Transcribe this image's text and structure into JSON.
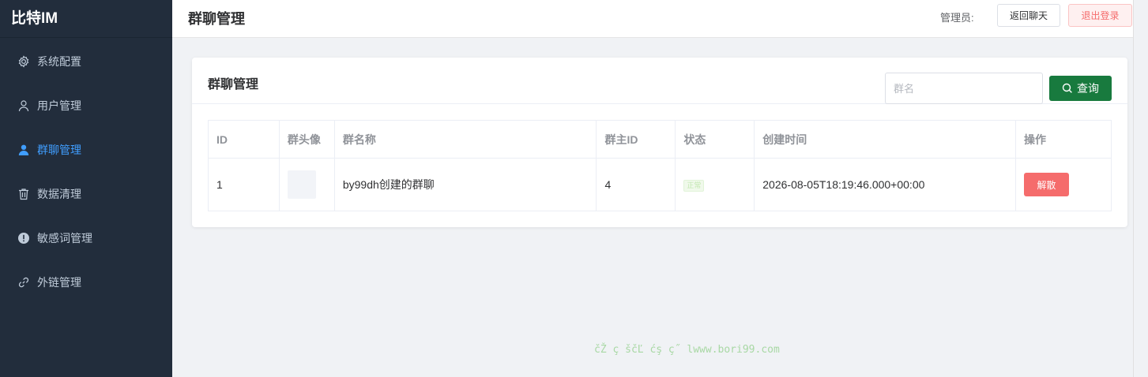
{
  "sidebar": {
    "brand": "比特IM",
    "items": [
      {
        "label": "系统配置",
        "icon": "gear-icon"
      },
      {
        "label": "用户管理",
        "icon": "user-outline-icon"
      },
      {
        "label": "群聊管理",
        "icon": "user-filled-icon",
        "active": true
      },
      {
        "label": "数据清理",
        "icon": "trash-icon"
      },
      {
        "label": "敏感词管理",
        "icon": "warning-icon"
      },
      {
        "label": "外链管理",
        "icon": "link-icon"
      }
    ]
  },
  "header": {
    "title": "群聊管理",
    "admin_label": "管理员:",
    "back_button": "返回聊天",
    "logout_button": "退出登录"
  },
  "card": {
    "title": "群聊管理",
    "search_placeholder": "群名",
    "query_button": "查询"
  },
  "table": {
    "columns": [
      "ID",
      "群头像",
      "群名称",
      "群主ID",
      "状态",
      "创建时间",
      "操作"
    ],
    "rows": [
      {
        "id": "1",
        "name": "by99dh创建的群聊",
        "owner_id": "4",
        "status": "正常",
        "created_at": "2026-08-05T18:19:46.000+00:00",
        "action": "解散"
      }
    ]
  },
  "watermark": "čŽ ç ščĽ ćş ç˝ lwww.bori99.com",
  "colors": {
    "sidebar_bg": "#222d3c",
    "active_menu": "#409eff",
    "query_button": "#187a3e",
    "danger": "#f56c6c"
  }
}
